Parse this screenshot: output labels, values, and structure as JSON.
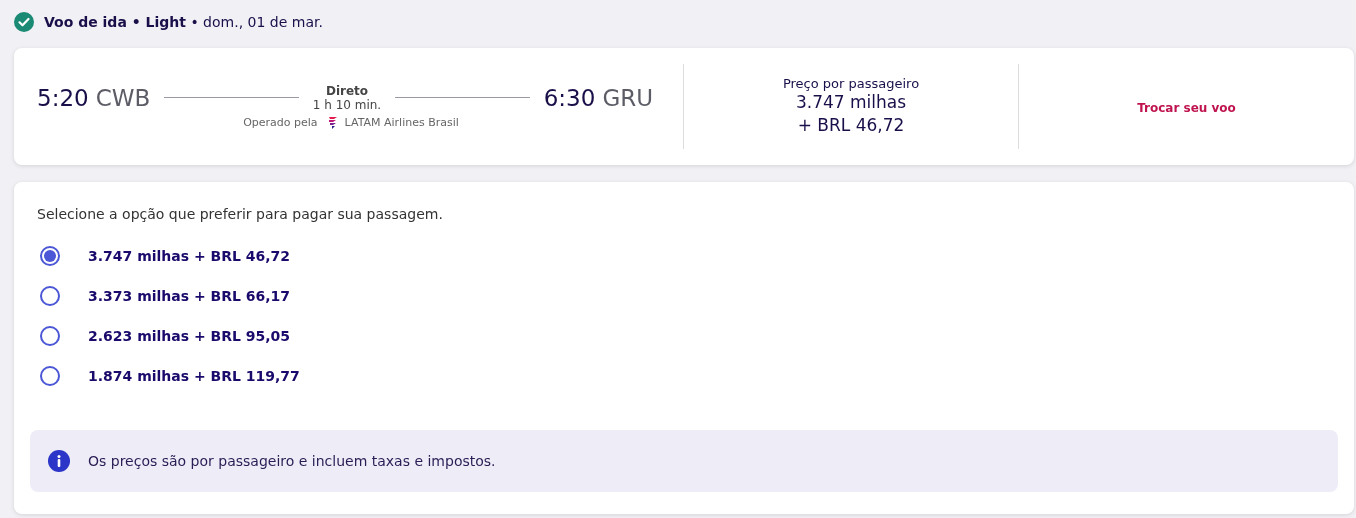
{
  "header": {
    "text": "**Voo de ida • Light** • dom., 01 de mar.",
    "done": true
  },
  "flight": {
    "departure": {
      "time": "5:20",
      "airport": "CWB"
    },
    "arrival": {
      "time": "6:30",
      "airport": "GRU"
    },
    "stops": "Direto",
    "duration": "1 h 10 min.",
    "operated_label": "Operado pela",
    "airline": "LATAM Airlines Brasil"
  },
  "price": {
    "label": "Preço por passageiro",
    "miles": "3.747 milhas",
    "cash": "+ BRL 46,72"
  },
  "change_link": "Trocar seu voo",
  "payment": {
    "prompt": "Selecione a opção que preferir para pagar sua passagem.",
    "options": [
      {
        "label": "3.747 milhas + BRL 46,72",
        "selected": true
      },
      {
        "label": "3.373 milhas + BRL 66,17",
        "selected": false
      },
      {
        "label": "2.623 milhas + BRL 95,05",
        "selected": false
      },
      {
        "label": "1.874 milhas + BRL 119,77",
        "selected": false
      }
    ],
    "notice": "Os preços são por passageiro e incluem taxas e impostos."
  }
}
